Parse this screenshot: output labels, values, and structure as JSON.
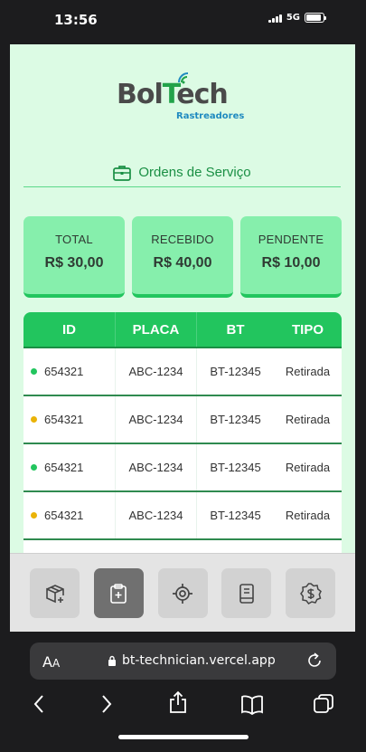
{
  "status_bar": {
    "time": "13:56",
    "network": "5G",
    "battery_level": 0.9
  },
  "brand": {
    "name_part1": "Bol",
    "name_part2": "T",
    "name_part3": "ech",
    "subtitle": "Rastreadores",
    "green": "#22a34a",
    "blue": "#1f8ac0"
  },
  "page": {
    "title": "Ordens de Serviço",
    "title_icon": "briefcase-icon"
  },
  "summary": [
    {
      "label": "TOTAL",
      "value": "R$ 30,00"
    },
    {
      "label": "RECEBIDO",
      "value": "R$ 40,00"
    },
    {
      "label": "PENDENTE",
      "value": "R$ 10,00"
    }
  ],
  "table": {
    "columns": [
      "ID",
      "PLACA",
      "BT",
      "TIPO"
    ],
    "rows": [
      {
        "status_color": "#22c55e",
        "id": "654321",
        "placa": "ABC-1234",
        "bt": "BT-12345",
        "tipo": "Retirada"
      },
      {
        "status_color": "#eab308",
        "id": "654321",
        "placa": "ABC-1234",
        "bt": "BT-12345",
        "tipo": "Retirada"
      },
      {
        "status_color": "#22c55e",
        "id": "654321",
        "placa": "ABC-1234",
        "bt": "BT-12345",
        "tipo": "Retirada"
      },
      {
        "status_color": "#eab308",
        "id": "654321",
        "placa": "ABC-1234",
        "bt": "BT-12345",
        "tipo": "Retirada"
      }
    ]
  },
  "bottom_nav": [
    {
      "icon": "package-plus-icon",
      "active": false
    },
    {
      "icon": "clipboard-plus-icon",
      "active": true
    },
    {
      "icon": "locate-icon",
      "active": false
    },
    {
      "icon": "book-icon",
      "active": false
    },
    {
      "icon": "dollar-badge-icon",
      "active": false
    }
  ],
  "browser": {
    "text_size_label_big": "A",
    "text_size_label_small": "A",
    "url": "bt-technician.vercel.app"
  },
  "colors": {
    "accent": "#22c55e",
    "card": "#86efac",
    "background": "#dcfbe4",
    "pending": "#eab308"
  }
}
